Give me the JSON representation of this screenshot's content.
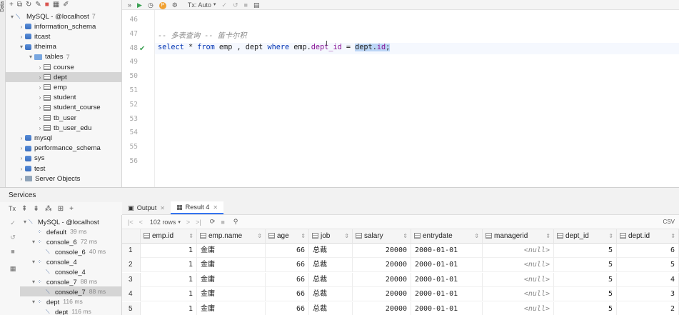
{
  "left_strip": {
    "label": "Data"
  },
  "db_toolbar": {
    "icons": [
      "add-icon",
      "copy-icon",
      "refresh-icon",
      "edit-icon",
      "stop-icon",
      "table-icon",
      "pencil-icon"
    ]
  },
  "db_tree": [
    {
      "label": "MySQL - @localhost",
      "count": "7",
      "icon": "mysql",
      "indent": 0,
      "arrow": "▾"
    },
    {
      "label": "information_schema",
      "count": "",
      "icon": "db",
      "indent": 1,
      "arrow": "›"
    },
    {
      "label": "itcast",
      "count": "",
      "icon": "db",
      "indent": 1,
      "arrow": "›"
    },
    {
      "label": "itheima",
      "count": "",
      "icon": "db",
      "indent": 1,
      "arrow": "▾"
    },
    {
      "label": "tables",
      "count": "7",
      "icon": "folder",
      "indent": 2,
      "arrow": "▾"
    },
    {
      "label": "course",
      "count": "",
      "icon": "table",
      "indent": 3,
      "arrow": "›"
    },
    {
      "label": "dept",
      "count": "",
      "icon": "table",
      "indent": 3,
      "arrow": "›",
      "selected": true
    },
    {
      "label": "emp",
      "count": "",
      "icon": "table",
      "indent": 3,
      "arrow": "›"
    },
    {
      "label": "student",
      "count": "",
      "icon": "table",
      "indent": 3,
      "arrow": "›"
    },
    {
      "label": "student_course",
      "count": "",
      "icon": "table",
      "indent": 3,
      "arrow": "›"
    },
    {
      "label": "tb_user",
      "count": "",
      "icon": "table",
      "indent": 3,
      "arrow": "›"
    },
    {
      "label": "tb_user_edu",
      "count": "",
      "icon": "table",
      "indent": 3,
      "arrow": "›"
    },
    {
      "label": "mysql",
      "count": "",
      "icon": "db",
      "indent": 1,
      "arrow": "›"
    },
    {
      "label": "performance_schema",
      "count": "",
      "icon": "db",
      "indent": 1,
      "arrow": "›"
    },
    {
      "label": "sys",
      "count": "",
      "icon": "db",
      "indent": 1,
      "arrow": "›"
    },
    {
      "label": "test",
      "count": "",
      "icon": "db",
      "indent": 1,
      "arrow": "›"
    },
    {
      "label": "Server Objects",
      "count": "",
      "icon": "server",
      "indent": 1,
      "arrow": "›"
    }
  ],
  "editor_toolbar": {
    "more": "»",
    "run": "▶",
    "history": "◷",
    "p_badge": "P",
    "settings": "⚙",
    "tx_mode": "Tx: Auto",
    "commit": "✓",
    "rollback": "↺",
    "stop": "■",
    "table": "▤"
  },
  "editor": {
    "line_numbers": [
      "46",
      "47",
      "48",
      "49",
      "50",
      "51",
      "52",
      "53",
      "54",
      "55",
      "56"
    ],
    "comment": "-- 多表查询 -- 笛卡尔积",
    "kw_select": "select",
    "star": "*",
    "kw_from": "from",
    "t_emp": "emp",
    "comma": ",",
    "t_dept": "dept",
    "kw_where": "where",
    "emp_prefix": "emp.",
    "fld_dept_id": "dept_id",
    "eq": "=",
    "sel_prefix": "dept.",
    "fld_id": "id",
    "semi": ";"
  },
  "services": {
    "title": "Services",
    "toolbar_icons": [
      "tx-icon",
      "collapse-all-icon",
      "expand-all-icon",
      "group-icon",
      "new-tab-icon",
      "add-icon"
    ],
    "tree": [
      {
        "label": "MySQL - @localhost",
        "time": "",
        "indent": 0,
        "arrow": "▾"
      },
      {
        "label": "default",
        "time": "39 ms",
        "indent": 1,
        "arrow": ""
      },
      {
        "label": "console_6",
        "time": "72 ms",
        "indent": 1,
        "arrow": "▾"
      },
      {
        "label": "console_6",
        "time": "40 ms",
        "indent": 2,
        "arrow": ""
      },
      {
        "label": "console_4",
        "time": "",
        "indent": 1,
        "arrow": "▾"
      },
      {
        "label": "console_4",
        "time": "",
        "indent": 2,
        "arrow": ""
      },
      {
        "label": "console_7",
        "time": "88 ms",
        "indent": 1,
        "arrow": "▾"
      },
      {
        "label": "console_7",
        "time": "88 ms",
        "indent": 2,
        "arrow": "",
        "selected": true
      },
      {
        "label": "dept",
        "time": "116 ms",
        "indent": 1,
        "arrow": "▾"
      },
      {
        "label": "dept",
        "time": "116 ms",
        "indent": 2,
        "arrow": ""
      }
    ]
  },
  "results": {
    "tabs": [
      {
        "label": "Output",
        "active": false
      },
      {
        "label": "Result 4",
        "active": true
      }
    ],
    "toolbar": {
      "first": "|<",
      "prev": "<",
      "rows": "102 rows",
      "next": ">",
      "last": ">|",
      "refresh": "⟳",
      "stop": "■",
      "pin": "📌",
      "csv": "CSV"
    },
    "columns": [
      "emp.id",
      "emp.name",
      "age",
      "job",
      "salary",
      "entrydate",
      "managerid",
      "dept_id",
      "dept.id"
    ],
    "rows": [
      [
        "1",
        "1",
        "金庸",
        "66",
        "总裁",
        "20000",
        "2000-01-01",
        "<null>",
        "5",
        "6"
      ],
      [
        "2",
        "1",
        "金庸",
        "66",
        "总裁",
        "20000",
        "2000-01-01",
        "<null>",
        "5",
        "5"
      ],
      [
        "3",
        "1",
        "金庸",
        "66",
        "总裁",
        "20000",
        "2000-01-01",
        "<null>",
        "5",
        "4"
      ],
      [
        "4",
        "1",
        "金庸",
        "66",
        "总裁",
        "20000",
        "2000-01-01",
        "<null>",
        "5",
        "3"
      ],
      [
        "5",
        "1",
        "金庸",
        "66",
        "总裁",
        "20000",
        "2000-01-01",
        "<null>",
        "5",
        "2"
      ]
    ]
  },
  "colors": {
    "accent": "#3574f0",
    "keyword": "#0033b3",
    "field": "#871094",
    "selection": "#bcd6f6",
    "check": "#3aa052"
  }
}
